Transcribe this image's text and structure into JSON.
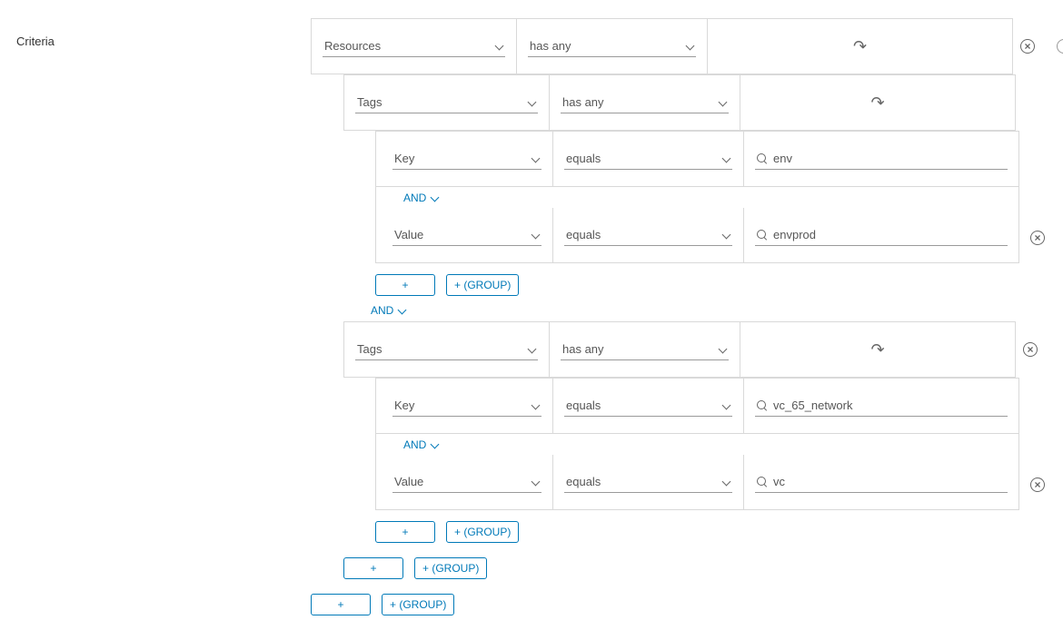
{
  "labels": {
    "criteria": "Criteria",
    "add_plus": "+",
    "add_group": "+ (GROUP)",
    "and": "AND"
  },
  "root": {
    "subject": "Resources",
    "operator": "has any"
  },
  "tags_a": {
    "subject": "Tags",
    "operator": "has any",
    "key": {
      "field": "Key",
      "op": "equals",
      "value": "env"
    },
    "value": {
      "field": "Value",
      "op": "equals",
      "value": "envprod"
    }
  },
  "tags_b": {
    "subject": "Tags",
    "operator": "has any",
    "key": {
      "field": "Key",
      "op": "equals",
      "value": "vc_65_network"
    },
    "value": {
      "field": "Value",
      "op": "equals",
      "value": "vc"
    }
  }
}
